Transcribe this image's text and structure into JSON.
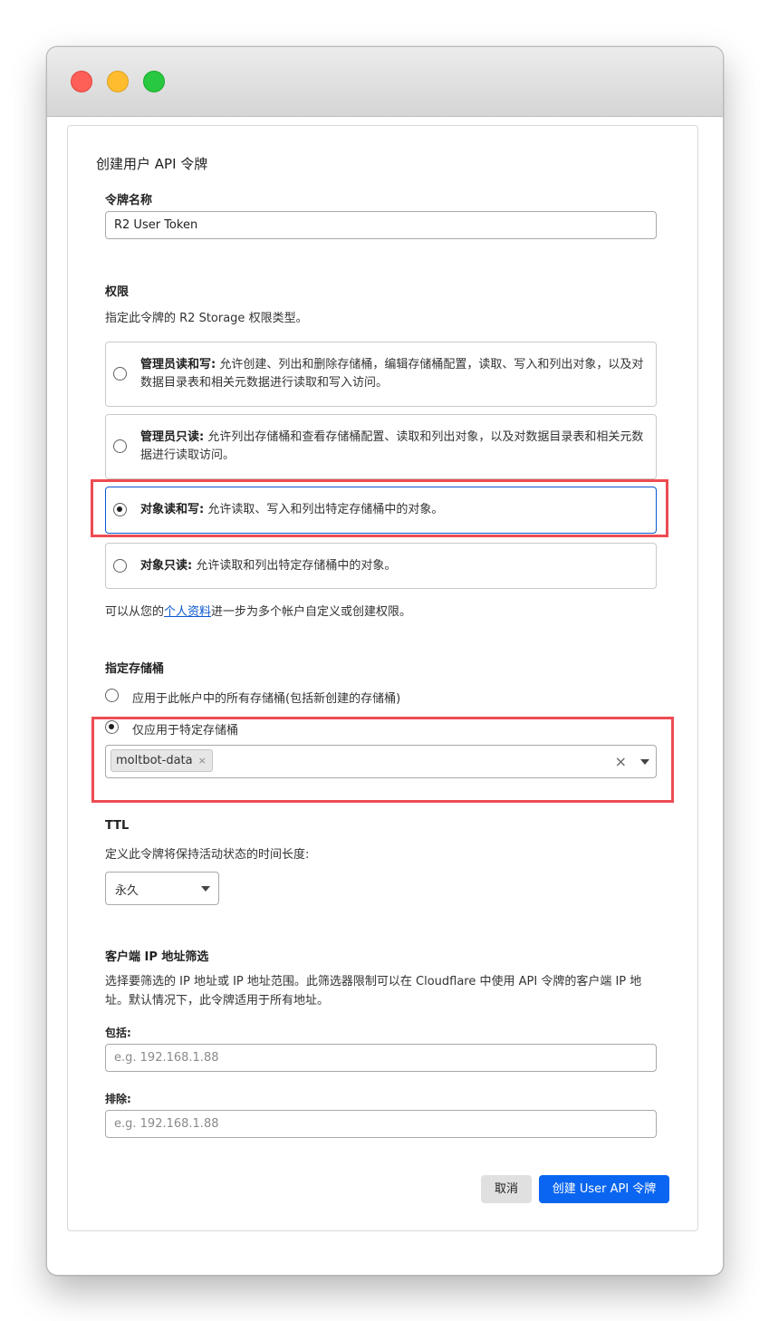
{
  "window": {
    "controls": [
      "close",
      "minimize",
      "zoom"
    ]
  },
  "dialog": {
    "title": "创建用户 API 令牌",
    "token_name": {
      "label": "令牌名称",
      "value": "R2 User Token"
    },
    "permissions": {
      "label": "权限",
      "description": "指定此令牌的 R2 Storage 权限类型。",
      "options": [
        {
          "title": "管理员读和写:",
          "text": " 允许创建、列出和删除存储桶，编辑存储桶配置，读取、写入和列出对象，以及对数据目录表和相关元数据进行读取和写入访问。",
          "selected": false
        },
        {
          "title": "管理员只读:",
          "text": " 允许列出存储桶和查看存储桶配置、读取和列出对象，以及对数据目录表和相关元数据进行读取访问。",
          "selected": false
        },
        {
          "title": "对象读和写:",
          "text": " 允许读取、写入和列出特定存储桶中的对象。",
          "selected": true
        },
        {
          "title": "对象只读:",
          "text": " 允许读取和列出特定存储桶中的对象。",
          "selected": false
        }
      ],
      "footer_prefix": "可以从您的",
      "footer_link": "个人资料",
      "footer_suffix": "进一步为多个帐户自定义或创建权限。"
    },
    "buckets": {
      "label": "指定存储桶",
      "option_all": "应用于此帐户中的所有存储桶(包括新创建的存储桶)",
      "option_specific": "仅应用于特定存储桶",
      "selected_option": "specific",
      "selected_bucket": "moltbot-data",
      "tag_remove": "×",
      "clear_icon": "×"
    },
    "ttl": {
      "label": "TTL",
      "description": "定义此令牌将保持活动状态的时间长度:",
      "value": "永久"
    },
    "ip_filter": {
      "label": "客户端 IP 地址筛选",
      "description_line1": "选择要筛选的 IP 地址或 IP 地址范围。此筛选器限制可以在 Cloudflare 中使用 API 令牌的客户端 IP 地",
      "description_line2": "址。默认情况下，此令牌适用于所有地址。",
      "include_label": "包括:",
      "include_placeholder": "e.g. 192.168.1.88",
      "exclude_label": "排除:",
      "exclude_placeholder": "e.g. 192.168.1.88"
    },
    "buttons": {
      "cancel": "取消",
      "create": "创建 User API 令牌"
    }
  },
  "colors": {
    "accent": "#0a66f0",
    "highlight": "#ee4b52",
    "link": "#0b57d0"
  }
}
